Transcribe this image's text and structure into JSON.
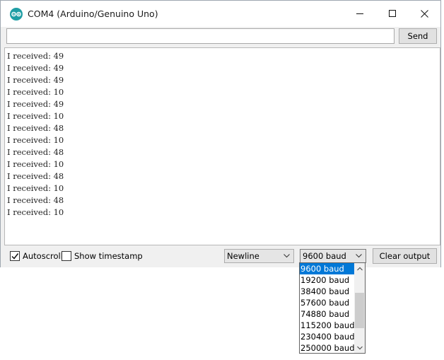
{
  "window": {
    "title": "COM4 (Arduino/Genuino Uno)"
  },
  "input": {
    "value": "",
    "send_label": "Send"
  },
  "output": {
    "lines": [
      "I received: 49",
      "I received: 49",
      "I received: 49",
      "I received: 10",
      "I received: 49",
      "I received: 10",
      "I received: 48",
      "I received: 10",
      "I received: 48",
      "I received: 10",
      "I received: 48",
      "I received: 10",
      "I received: 48",
      "I received: 10"
    ]
  },
  "bottom": {
    "autoscroll_label": "Autoscroll",
    "autoscroll_checked": true,
    "timestamp_label": "Show timestamp",
    "timestamp_checked": false,
    "line_ending": "Newline",
    "baud": "9600 baud",
    "clear_label": "Clear output"
  },
  "baud_dropdown": {
    "options": [
      "9600 baud",
      "19200 baud",
      "38400 baud",
      "57600 baud",
      "74880 baud",
      "115200 baud",
      "230400 baud",
      "250000 baud"
    ],
    "selected_index": 0
  },
  "icons": {
    "app": "arduino-logo-icon",
    "minimize": "minimize-icon",
    "maximize": "maximize-icon",
    "close": "close-icon",
    "dropdown_arrow": "chevron-down-icon",
    "checkbox_check": "check-icon"
  },
  "colors": {
    "arduino_teal": "#1f9ea5",
    "selection": "#0078d7"
  }
}
